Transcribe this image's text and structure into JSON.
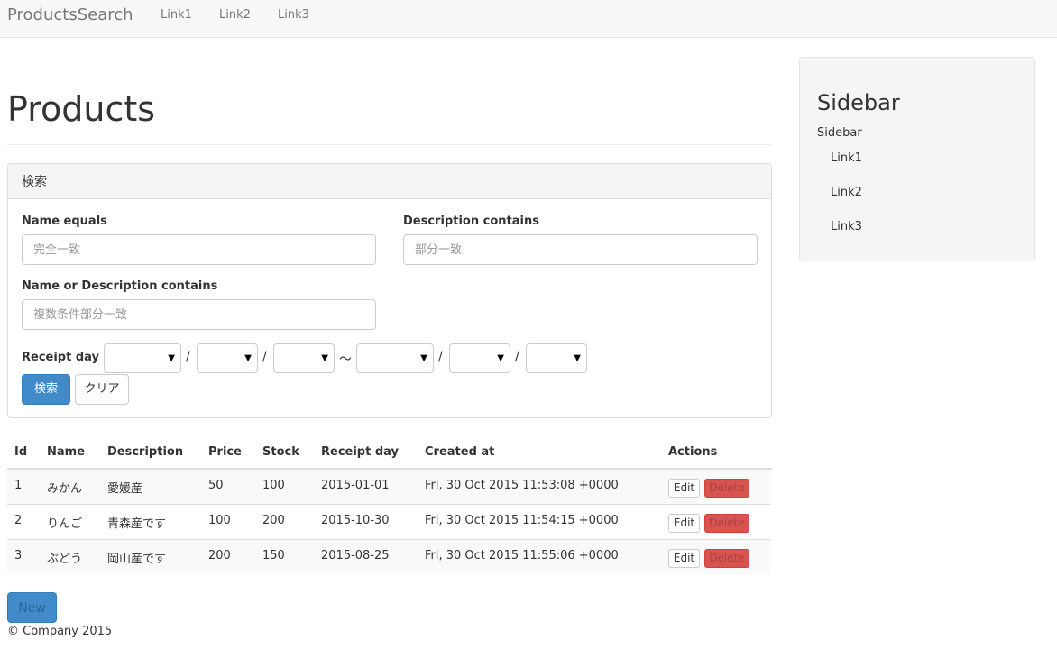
{
  "navbar": {
    "brand": "ProductsSearch",
    "links": [
      "Link1",
      "Link2",
      "Link3"
    ]
  },
  "main": {
    "title": "Products"
  },
  "search": {
    "heading": "検索",
    "name_equals_label": "Name equals",
    "name_equals_placeholder": "完全一致",
    "name_equals_value": "",
    "description_contains_label": "Description contains",
    "description_contains_placeholder": "部分一致",
    "description_contains_value": "",
    "name_or_description_label": "Name or Description contains",
    "name_or_description_placeholder": "複数条件部分一致",
    "name_or_description_value": "",
    "receipt_day_label": "Receipt day",
    "date_separator": "/",
    "range_separator": "〜",
    "receipt_day_from": {
      "year": "",
      "month": "",
      "day": ""
    },
    "receipt_day_to": {
      "year": "",
      "month": "",
      "day": ""
    },
    "search_button": "検索",
    "clear_button": "クリア"
  },
  "table": {
    "headers": [
      "Id",
      "Name",
      "Description",
      "Price",
      "Stock",
      "Receipt day",
      "Created at",
      "Actions"
    ],
    "rows": [
      {
        "id": "1",
        "name": "みかん",
        "description": "愛媛産",
        "price": "50",
        "stock": "100",
        "receipt_day": "2015-01-01",
        "created_at": "Fri, 30 Oct 2015 11:53:08 +0000"
      },
      {
        "id": "2",
        "name": "りんご",
        "description": "青森産です",
        "price": "100",
        "stock": "200",
        "receipt_day": "2015-10-30",
        "created_at": "Fri, 30 Oct 2015 11:54:15 +0000"
      },
      {
        "id": "3",
        "name": "ぶどう",
        "description": "岡山産です",
        "price": "200",
        "stock": "150",
        "receipt_day": "2015-08-25",
        "created_at": "Fri, 30 Oct 2015 11:55:06 +0000"
      }
    ],
    "edit_label": "Edit",
    "delete_label": "Delete"
  },
  "new_button": "New",
  "footer": "© Company 2015",
  "sidebar": {
    "title": "Sidebar",
    "subtitle": "Sidebar",
    "links": [
      "Link1",
      "Link2",
      "Link3"
    ]
  },
  "colors": {
    "primary": "#428bca",
    "danger": "#d9534f",
    "navbar_bg": "#f8f8f8",
    "panel_heading_bg": "#f5f5f5"
  },
  "icons": {
    "select_caret": "caret-down-icon"
  }
}
